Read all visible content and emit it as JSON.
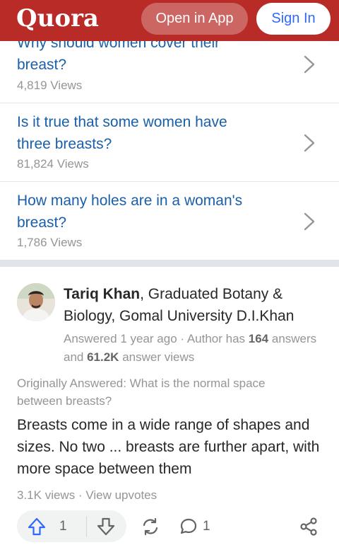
{
  "header": {
    "logo": "Quora",
    "open_in_app": "Open in App",
    "sign_in": "Sign In",
    "brand_color": "#b92b27"
  },
  "related_questions": [
    {
      "title": "Why should women cover their breast?",
      "title_line1": "Why should women cover their",
      "title_line2": "breast?",
      "views": "4,819 Views"
    },
    {
      "title": "Is it true that some women have three breasts?",
      "title_line1": "Is it true that some women have",
      "title_line2": "three breasts?",
      "views": "81,824 Views"
    },
    {
      "title": "How many holes are in a woman's breast?",
      "title_line1": "How many holes are in a woman's",
      "title_line2": "breast?",
      "views": "1,786 Views"
    }
  ],
  "answer": {
    "author_name": "Tariq Khan",
    "author_credential": ", Graduated Botany & Biology, Gomal University D.I.Khan",
    "answered_prefix": "Answered 1 year ago · Author has ",
    "answer_count": "164",
    "answers_and": " answers and ",
    "answer_views": "61.2K",
    "answer_views_suffix": " answer views",
    "originally_answered": "Originally Answered: What is the normal space between breasts?",
    "text": "Breasts come in a wide range of shapes and sizes. No two ... breasts are further apart, with more space between them",
    "views": "3.1K views",
    "separator": " · ",
    "view_upvotes": "View upvotes",
    "upvotes": "1",
    "comments": "1"
  },
  "icons": {
    "chevron": "chevron-right-icon",
    "upvote": "upvote-arrow-icon",
    "downvote": "downvote-arrow-icon",
    "reshare": "reshare-icon",
    "comment": "comment-bubble-icon",
    "share": "share-icon"
  },
  "colors": {
    "link": "#195faa",
    "accent_blue": "#2e69ff",
    "muted": "#939598"
  }
}
